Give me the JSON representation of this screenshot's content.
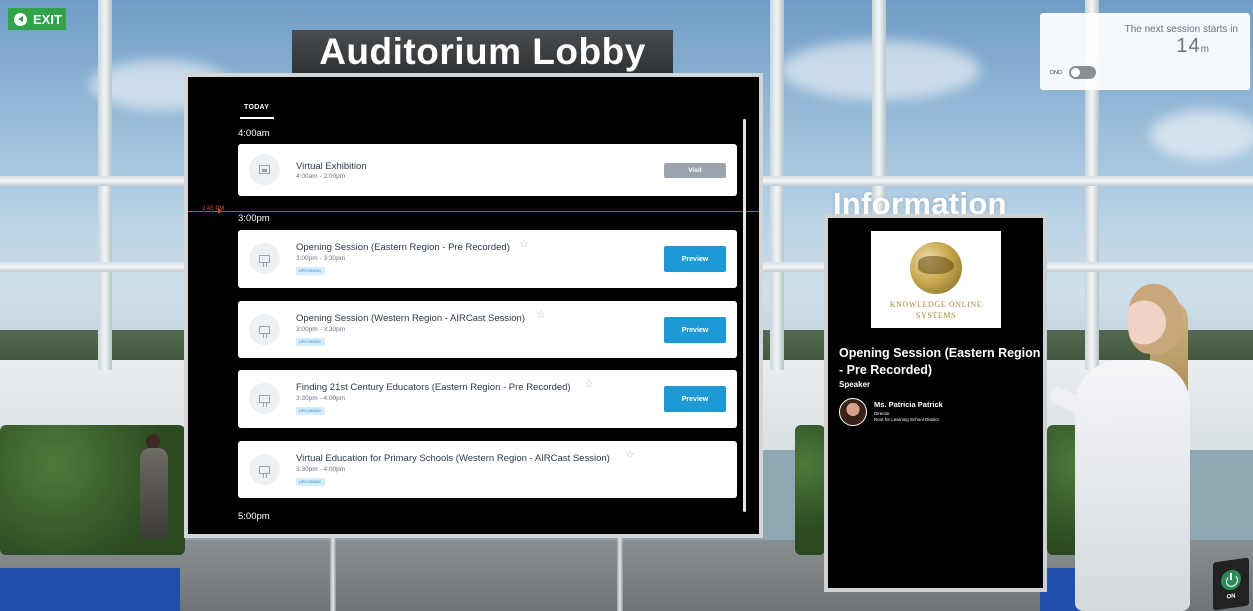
{
  "top": {
    "exit_label": "EXIT"
  },
  "lobby": {
    "title": "Auditorium Lobby"
  },
  "schedule": {
    "tab_today": "TODAY",
    "now_label": "2:45 PM",
    "time_slots": [
      "4:00am",
      "3:00pm",
      "5:00pm"
    ],
    "sessions": [
      {
        "title": "Virtual Exhibition",
        "time": "4:00am - 2:00pm",
        "badge": "",
        "action": "Visit",
        "icon": "exhibition-icon"
      },
      {
        "title": "Opening Session (Eastern Region - Pre Recorded)",
        "time": "3:00pm - 3:30pm",
        "badge": "UPCOMING",
        "action": "Preview",
        "icon": "presentation-icon"
      },
      {
        "title": "Opening Session (Western Region - AIRCast Session)",
        "time": "3:00pm - 3:30pm",
        "badge": "UPCOMING",
        "action": "Preview",
        "icon": "presentation-icon"
      },
      {
        "title": "Finding 21st Century Educators (Eastern Region - Pre Recorded)",
        "time": "3:30pm - 4:00pm",
        "badge": "UPCOMING",
        "action": "Preview",
        "icon": "presentation-icon"
      },
      {
        "title": "Virtual Education for Primary Schools (Western Region - AIRCast Session)",
        "time": "3:30pm - 4:00pm",
        "badge": "UPCOMING",
        "action": "",
        "icon": "presentation-icon"
      }
    ]
  },
  "info": {
    "heading": "Information",
    "logo_text_line1": "KNOWLEDGE ONLINE",
    "logo_text_line2": "SYSTEMS",
    "session_title": "Opening Session (Eastern Region - Pre Recorded)",
    "speaker_label": "Speaker",
    "speaker": {
      "name": "Ms. Patricia Patrick",
      "role": "Director",
      "org": "Root for Learning School District"
    }
  },
  "widget": {
    "next_label": "The next session starts in",
    "count": "14",
    "unit": "m",
    "dnd_label": "DND",
    "dnd_on": false
  },
  "power": {
    "label": "ON"
  },
  "colors": {
    "accent_blue": "#1d9ad6",
    "now_line": "#d4472b",
    "exit_green": "#2fa24a"
  }
}
